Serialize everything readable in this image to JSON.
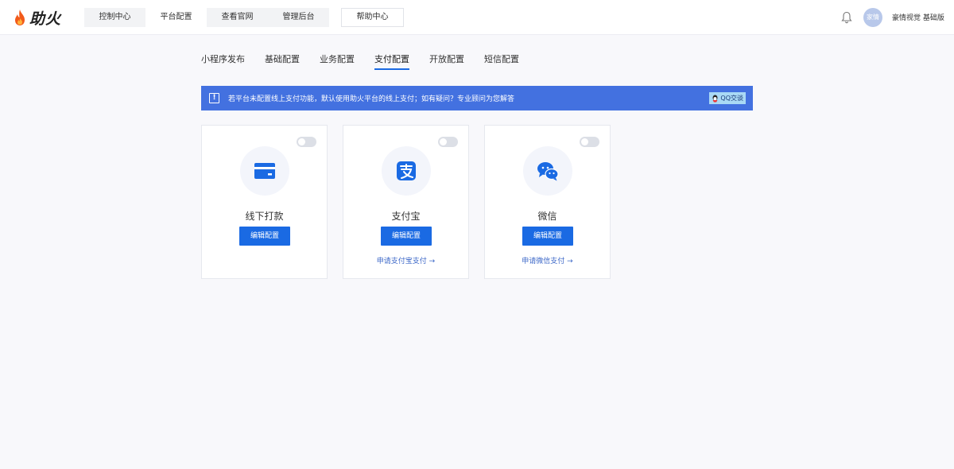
{
  "brand": {
    "name": "助火"
  },
  "topnav": {
    "items": [
      {
        "label": "控制中心"
      },
      {
        "label": "平台配置"
      },
      {
        "label": "查看官网"
      },
      {
        "label": "管理后台"
      }
    ],
    "active_index": 1,
    "help_label": "帮助中心"
  },
  "user": {
    "avatar_text": "家情",
    "account": "豪情视觉 基础版"
  },
  "subtabs": {
    "items": [
      {
        "label": "小程序发布"
      },
      {
        "label": "基础配置"
      },
      {
        "label": "业务配置"
      },
      {
        "label": "支付配置"
      },
      {
        "label": "开放配置"
      },
      {
        "label": "短信配置"
      }
    ],
    "active_index": 3
  },
  "notice": {
    "icon": "exclamation-icon",
    "text": "若平台未配置线上支付功能，默认使用助火平台的线上支付；如有疑问？专业顾问为您解答",
    "qq_label": "QQ交谈"
  },
  "payments": [
    {
      "title": "线下打款",
      "icon": "bank-card-icon",
      "button": "编辑配置",
      "enabled": false,
      "apply_link": ""
    },
    {
      "title": "支付宝",
      "icon": "alipay-icon",
      "button": "编辑配置",
      "enabled": false,
      "apply_link": "申请支付宝支付 →"
    },
    {
      "title": "微信",
      "icon": "wechat-icon",
      "button": "编辑配置",
      "enabled": false,
      "apply_link": "申请微信支付 →"
    }
  ],
  "colors": {
    "primary": "#1a6ae3",
    "notice_bg": "#4371e0",
    "page_bg": "#f8f8fb"
  }
}
